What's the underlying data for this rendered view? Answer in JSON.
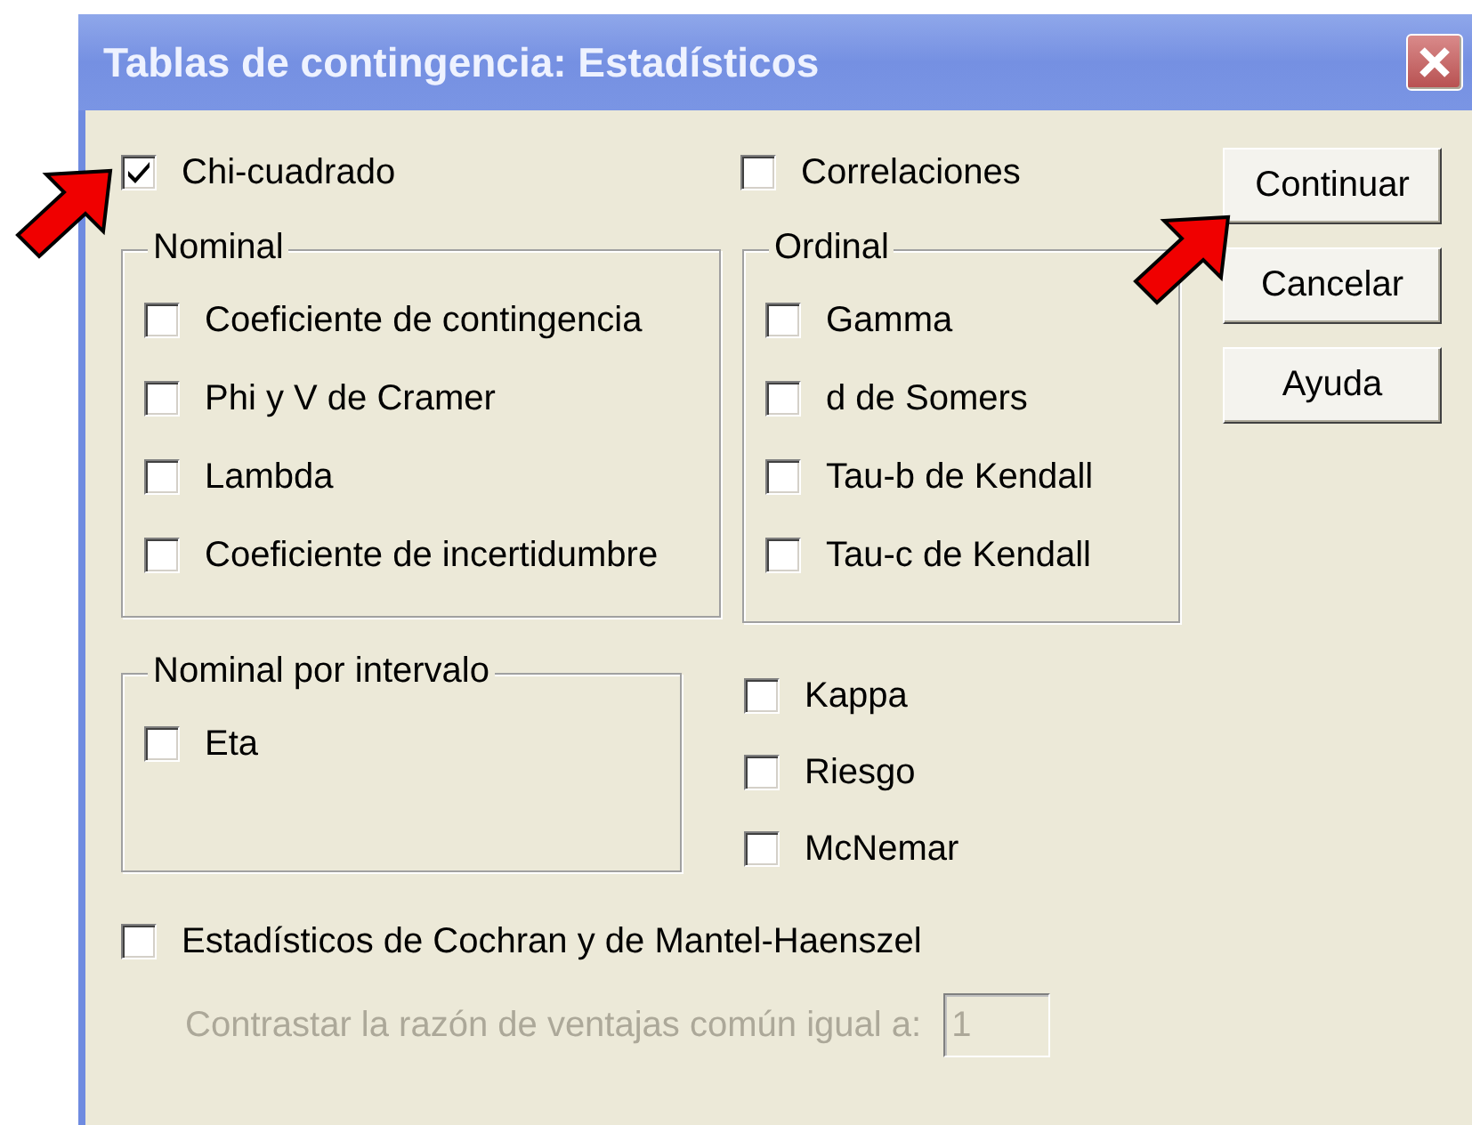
{
  "window": {
    "title": "Tablas de contingencia: Estadísticos"
  },
  "top_options": [
    {
      "label": "Chi-cuadrado",
      "checked": true
    },
    {
      "label": "Correlaciones",
      "checked": false
    }
  ],
  "groups": [
    {
      "title": "Nominal",
      "options": [
        {
          "label": "Coeficiente de contingencia",
          "checked": false
        },
        {
          "label": "Phi y V de Cramer",
          "checked": false
        },
        {
          "label": "Lambda",
          "checked": false
        },
        {
          "label": "Coeficiente de incertidumbre",
          "checked": false
        }
      ]
    },
    {
      "title": "Ordinal",
      "options": [
        {
          "label": "Gamma",
          "checked": false
        },
        {
          "label": "d de Somers",
          "checked": false
        },
        {
          "label": "Tau-b de Kendall",
          "checked": false
        },
        {
          "label": "Tau-c de Kendall",
          "checked": false
        }
      ]
    },
    {
      "title": "Nominal por intervalo",
      "options": [
        {
          "label": "Eta",
          "checked": false
        }
      ]
    }
  ],
  "extra_options": [
    {
      "label": "Kappa",
      "checked": false
    },
    {
      "label": "Riesgo",
      "checked": false
    },
    {
      "label": "McNemar",
      "checked": false
    }
  ],
  "cochran": {
    "label": "Estadísticos de Cochran y de Mantel-Haenszel",
    "checked": false
  },
  "odds_ratio": {
    "label": "Contrastar la razón de ventajas común igual a:",
    "value": "1",
    "disabled": true
  },
  "buttons": [
    "Continuar",
    "Cancelar",
    "Ayuda"
  ]
}
